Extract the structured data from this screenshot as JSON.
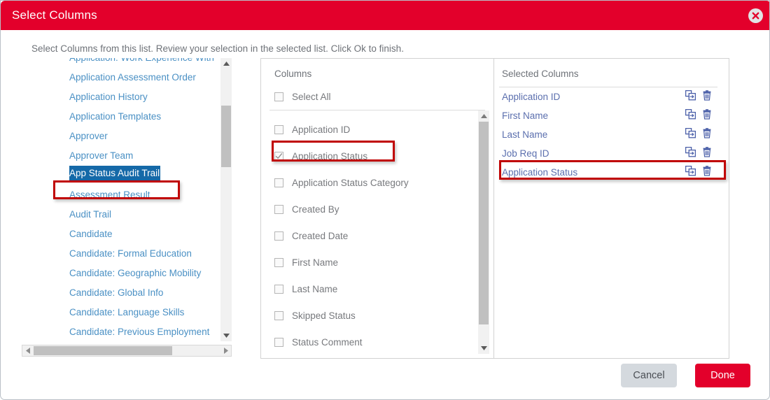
{
  "dialog": {
    "title": "Select Columns",
    "close_icon": "close-circle-icon",
    "instruction": "Select Columns from this list. Review your selection in the selected list. Click Ok to finish."
  },
  "tree": {
    "items": [
      {
        "label": "Application: Work Experience With",
        "selected": false
      },
      {
        "label": "Application Assessment Order",
        "selected": false
      },
      {
        "label": "Application History",
        "selected": false
      },
      {
        "label": "Application Templates",
        "selected": false
      },
      {
        "label": "Approver",
        "selected": false
      },
      {
        "label": "Approver Team",
        "selected": false
      },
      {
        "label": "App Status Audit Trail",
        "selected": true
      },
      {
        "label": "Assessment Result",
        "selected": false
      },
      {
        "label": "Audit Trail",
        "selected": false
      },
      {
        "label": "Candidate",
        "selected": false
      },
      {
        "label": "Candidate: Formal Education",
        "selected": false
      },
      {
        "label": "Candidate: Geographic Mobility",
        "selected": false
      },
      {
        "label": "Candidate: Global Info",
        "selected": false
      },
      {
        "label": "Candidate: Language Skills",
        "selected": false
      },
      {
        "label": "Candidate: Previous Employment",
        "selected": false
      }
    ]
  },
  "columns_panel": {
    "header": "Columns",
    "select_all_label": "Select All",
    "select_all_checked": false,
    "items": [
      {
        "label": "Application ID",
        "checked": false
      },
      {
        "label": "Application Status",
        "checked": true
      },
      {
        "label": "Application Status Category",
        "checked": false
      },
      {
        "label": "Created By",
        "checked": false
      },
      {
        "label": "Created Date",
        "checked": false
      },
      {
        "label": "First Name",
        "checked": false
      },
      {
        "label": "Last Name",
        "checked": false
      },
      {
        "label": "Skipped Status",
        "checked": false
      },
      {
        "label": "Status Comment",
        "checked": false
      }
    ]
  },
  "selected_panel": {
    "header": "Selected Columns",
    "row_icons": [
      "move-column-icon",
      "delete-column-icon"
    ],
    "items": [
      {
        "label": "Application ID",
        "highlighted": false
      },
      {
        "label": "First Name",
        "highlighted": false
      },
      {
        "label": "Last Name",
        "highlighted": false
      },
      {
        "label": "Job Req ID",
        "highlighted": false
      },
      {
        "label": "Application Status",
        "highlighted": true
      }
    ]
  },
  "footer": {
    "cancel_label": "Cancel",
    "done_label": "Done"
  },
  "colors": {
    "brand_red": "#e3002b",
    "highlight_box_red": "#c00000",
    "tree_link_blue": "#4a90c4",
    "tree_selected_blue": "#1569a8",
    "selected_item_blue": "#5b6fae",
    "cancel_gray": "#d4d9de"
  }
}
